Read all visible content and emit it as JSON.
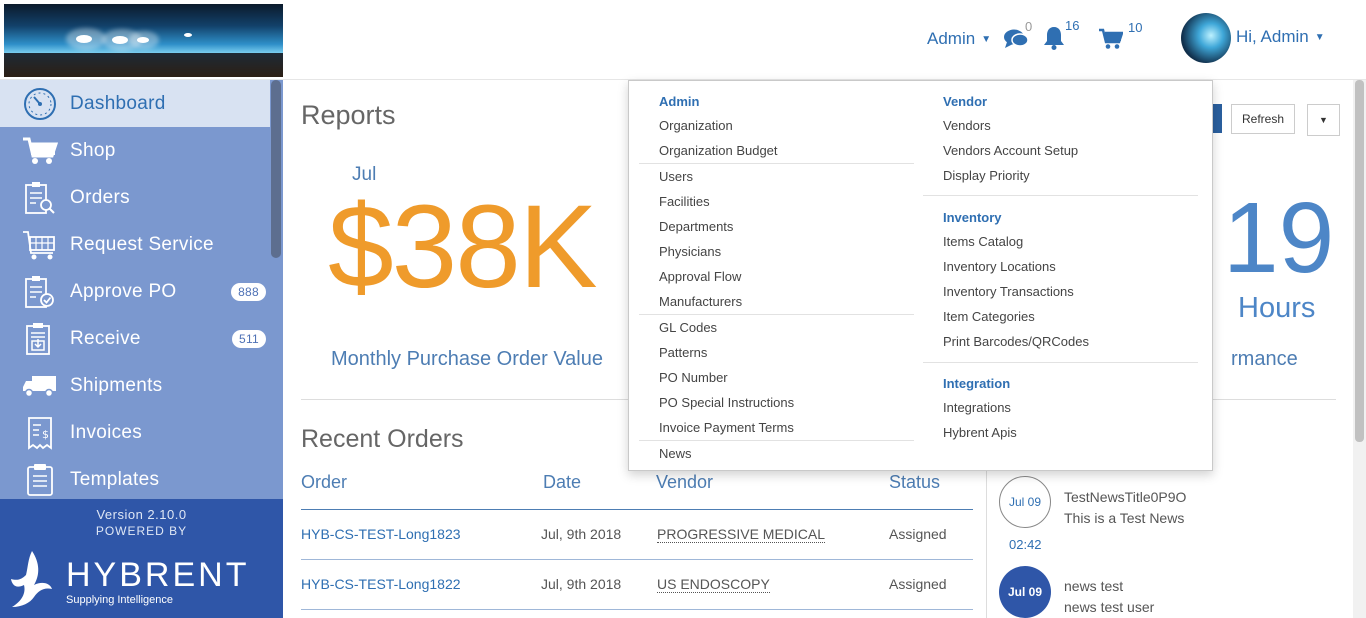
{
  "header": {
    "admin_label": "Admin",
    "chat_count": "0",
    "notifications_count": "16",
    "cart_count": "10",
    "user_greeting": "Hi, Admin"
  },
  "sidebar": {
    "items": [
      {
        "label": "Dashboard"
      },
      {
        "label": "Shop"
      },
      {
        "label": "Orders"
      },
      {
        "label": "Request Service"
      },
      {
        "label": "Approve PO",
        "badge": "888"
      },
      {
        "label": "Receive",
        "badge": "511"
      },
      {
        "label": "Shipments"
      },
      {
        "label": "Invoices"
      },
      {
        "label": "Templates"
      }
    ],
    "version": "Version 2.10.0",
    "powered_by": "POWERED BY",
    "brand": "HYBRENT",
    "tagline": "Supplying Intelligence"
  },
  "main": {
    "reports_title": "Reports",
    "refresh_label": "Refresh",
    "kpi1": {
      "month": "Jul",
      "value": "$38K",
      "label": "Monthly Purchase Order Value"
    },
    "kpi2": {
      "value": "19",
      "unit": "Hours",
      "label_partial": "rmance"
    },
    "recent_orders_title": "Recent Orders",
    "orders_columns": [
      "Order",
      "Date",
      "Vendor",
      "Status"
    ],
    "orders": [
      {
        "id": "HYB-CS-TEST-Long1823",
        "date": "Jul, 9th 2018",
        "vendor": "PROGRESSIVE MEDICAL",
        "status": "Assigned"
      },
      {
        "id": "HYB-CS-TEST-Long1822",
        "date": "Jul, 9th 2018",
        "vendor": "US ENDOSCOPY",
        "status": "Assigned"
      }
    ],
    "news": [
      {
        "date": "Jul 09",
        "time": "02:42",
        "title": "TestNewsTitle0P9O",
        "body": "This is a Test News"
      },
      {
        "date": "Jul 09",
        "title": "news test",
        "body": "news test user"
      }
    ]
  },
  "admin_menu": {
    "admin_head": "Admin",
    "admin_group1": [
      "Organization",
      "Organization Budget"
    ],
    "admin_group2": [
      "Users",
      "Facilities",
      "Departments",
      "Physicians",
      "Approval Flow",
      "Manufacturers"
    ],
    "admin_group3": [
      "GL Codes",
      "Patterns",
      "PO Number",
      "PO Special Instructions",
      "Invoice Payment Terms"
    ],
    "admin_group4": [
      "News"
    ],
    "vendor_head": "Vendor",
    "vendor_items": [
      "Vendors",
      "Vendors Account Setup",
      "Display Priority"
    ],
    "inventory_head": "Inventory",
    "inventory_items": [
      "Items Catalog",
      "Inventory Locations",
      "Inventory Transactions",
      "Item Categories",
      "Print Barcodes/QRCodes"
    ],
    "integration_head": "Integration",
    "integration_items": [
      "Integrations",
      "Hybrent Apis"
    ]
  },
  "colors": {
    "accent": "#2f6fb2",
    "sidebar": "#7b98cf",
    "sidebar_footer": "#2f56a8",
    "kpi_orange": "#ef9b2b"
  }
}
